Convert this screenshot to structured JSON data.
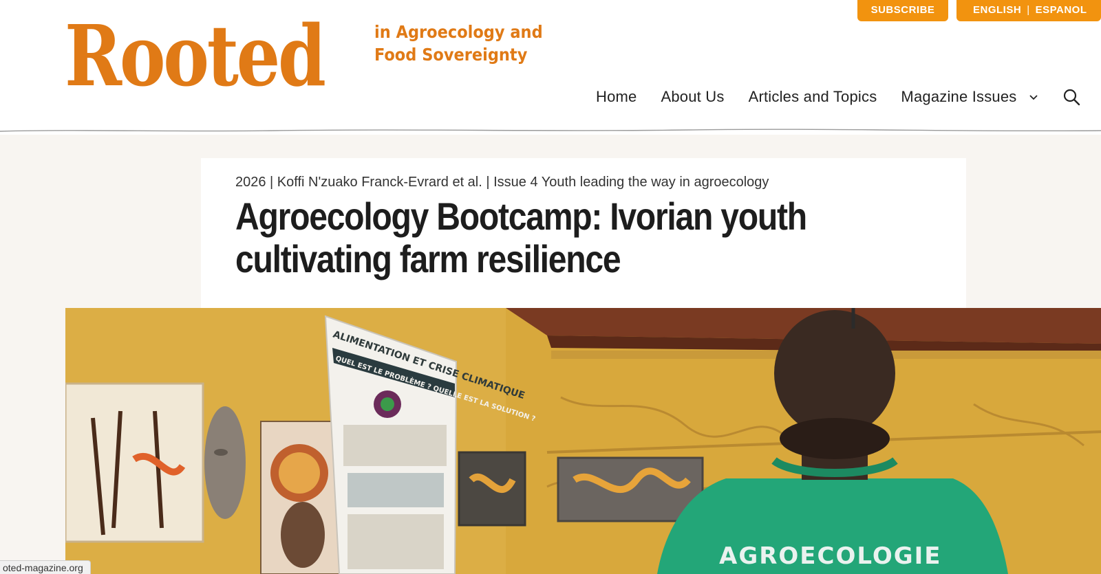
{
  "brand": {
    "logo_word": "Rooted",
    "tagline_line1": "in Agroecology and",
    "tagline_line2": "Food Sovereignty",
    "accent_color": "#e07a16",
    "button_color": "#f2930f"
  },
  "topbar": {
    "subscribe_label": "SUBSCRIBE",
    "lang_english": "ENGLISH",
    "lang_separator": "|",
    "lang_spanish": "ESPANOL"
  },
  "nav": {
    "items": [
      "Home",
      "About Us",
      "Articles and Topics",
      "Magazine Issues"
    ],
    "dropdown_icon": "chevron-down-icon",
    "search_icon": "search-icon"
  },
  "article": {
    "meta": "2026 | Koffi N'zuako Franck-Evrard et al. | Issue 4 Youth leading the way in agroecology",
    "title": "Agroecology Bootcamp: Ivorian youth cultivating farm resilience"
  },
  "hero": {
    "poster_line1": "ALIMENTATION ET CRISE CLIMATIQUE",
    "poster_line2": "QUEL EST LE PROBLÈME ? QUELLE EST LA SOLUTION ?",
    "shirt_text": "AGROECOLOGIE"
  },
  "statusbar": {
    "url": "oted-magazine.org"
  }
}
